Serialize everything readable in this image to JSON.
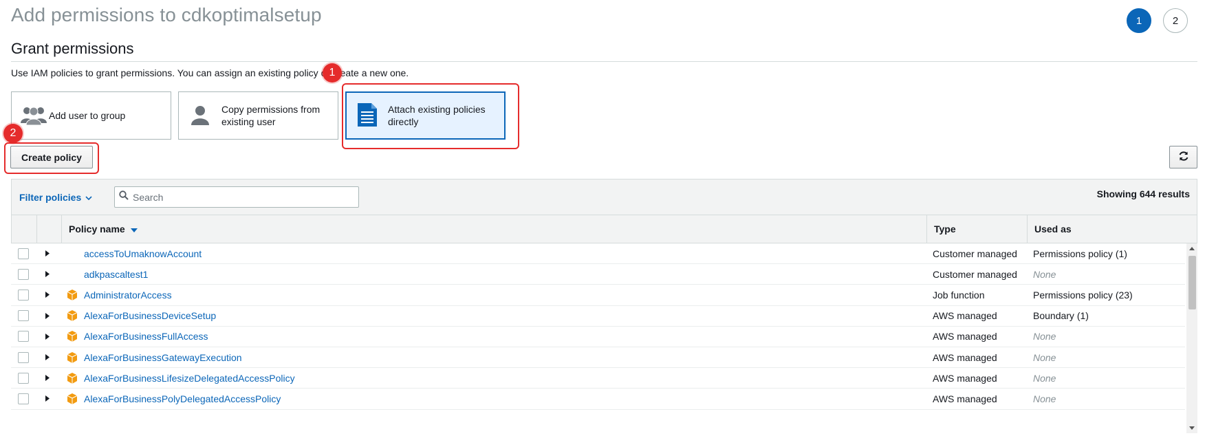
{
  "header": {
    "title": "Add permissions to cdkoptimalsetup",
    "steps": [
      "1",
      "2"
    ]
  },
  "section": {
    "title": "Grant permissions",
    "intro": "Use IAM policies to grant permissions. You can assign an existing policy or create a new one."
  },
  "options": [
    {
      "label": "Add user to group",
      "icon": "user-group-icon"
    },
    {
      "label": "Copy permissions from existing user",
      "icon": "user-icon"
    },
    {
      "label": "Attach existing policies directly",
      "icon": "document-icon",
      "selected": true
    }
  ],
  "annotations": {
    "badge1": "1",
    "badge2": "2",
    "color": "#e52b2b"
  },
  "toolbar": {
    "create_policy": "Create policy",
    "filter_label": "Filter policies",
    "search_placeholder": "Search",
    "results": "Showing 644 results",
    "refresh_icon": "refresh-icon"
  },
  "table": {
    "columns": {
      "name": "Policy name",
      "type": "Type",
      "used_as": "Used as"
    },
    "rows": [
      {
        "name": "accessToUmaknowAccount",
        "type": "Customer managed",
        "used_as": "Permissions policy (1)",
        "aws_icon": false
      },
      {
        "name": "adkpascaltest1",
        "type": "Customer managed",
        "used_as": "None",
        "aws_icon": false
      },
      {
        "name": "AdministratorAccess",
        "type": "Job function",
        "used_as": "Permissions policy (23)",
        "aws_icon": true
      },
      {
        "name": "AlexaForBusinessDeviceSetup",
        "type": "AWS managed",
        "used_as": "Boundary (1)",
        "aws_icon": true
      },
      {
        "name": "AlexaForBusinessFullAccess",
        "type": "AWS managed",
        "used_as": "None",
        "aws_icon": true
      },
      {
        "name": "AlexaForBusinessGatewayExecution",
        "type": "AWS managed",
        "used_as": "None",
        "aws_icon": true
      },
      {
        "name": "AlexaForBusinessLifesizeDelegatedAccessPolicy",
        "type": "AWS managed",
        "used_as": "None",
        "aws_icon": true
      },
      {
        "name": "AlexaForBusinessPolyDelegatedAccessPolicy",
        "type": "AWS managed",
        "used_as": "None",
        "aws_icon": true
      }
    ]
  },
  "colors": {
    "link": "#0b66b8",
    "accent": "#0b66b8",
    "aws_icon": "#f90",
    "highlight": "#e52b2b"
  }
}
